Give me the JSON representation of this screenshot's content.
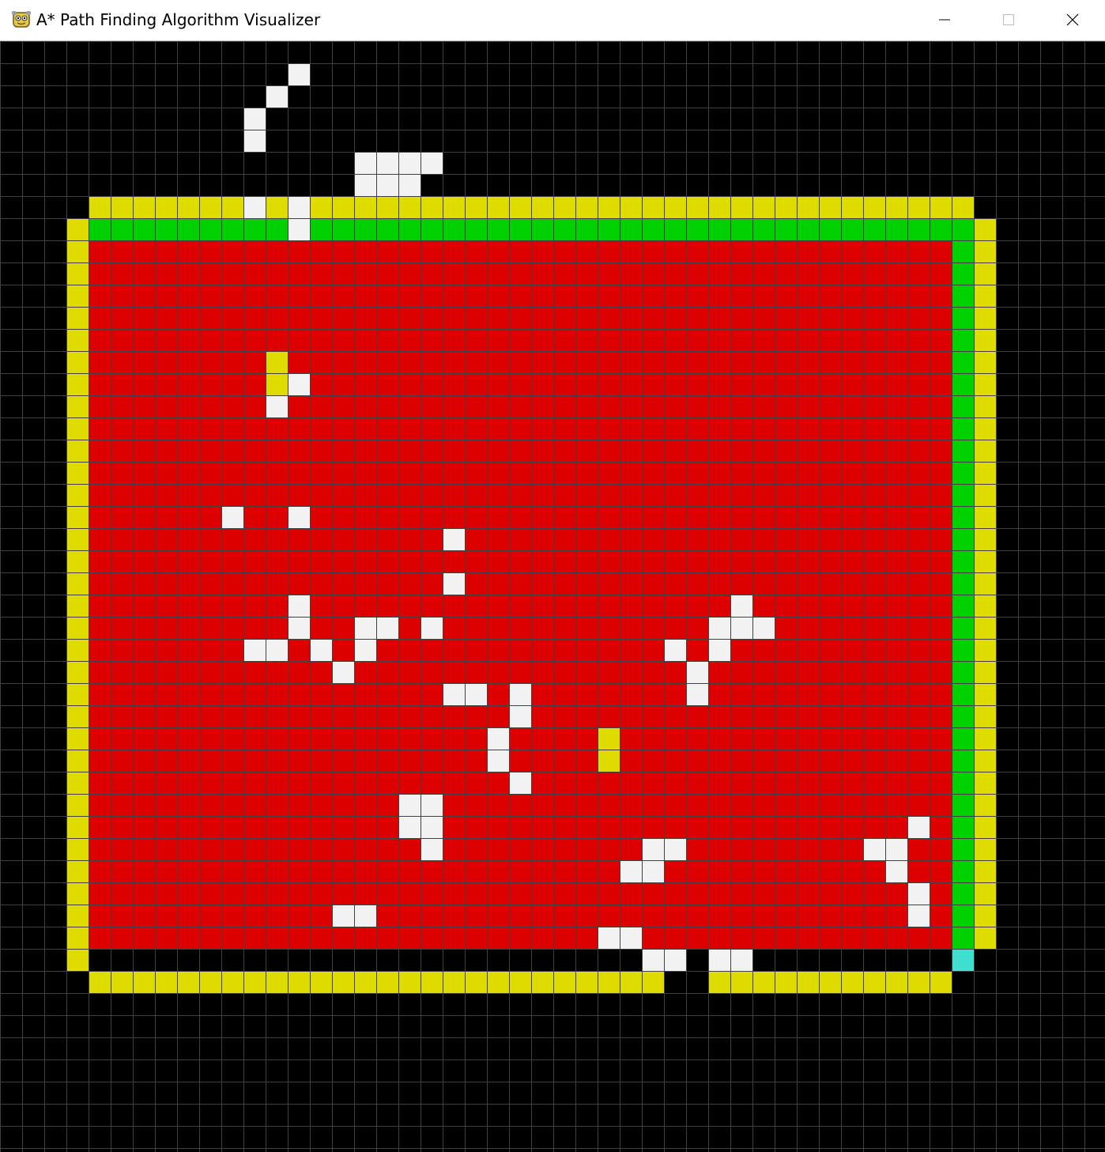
{
  "window": {
    "title": "A* Path Finding Algorithm Visualizer",
    "icon": "pygame-snake-icon",
    "controls": [
      "minimize-icon",
      "maximize-icon",
      "close-icon"
    ]
  },
  "colors": {
    "background": "#000000",
    "gridline": "#404040",
    "closed": "#dd0000",
    "open": "#e0dc00",
    "path": "#00d000",
    "barrier": "#f2f2f2",
    "end": "#40e0d0"
  },
  "grid": {
    "cols": 50,
    "rows": 50,
    "red_region": {
      "col_start": 4,
      "col_end": 42,
      "row_start": 9,
      "row_end": 40
    },
    "green_path": [
      {
        "col_from": 4,
        "col_to": 43,
        "row": 8
      },
      {
        "col": 43,
        "row_from": 8,
        "row_to": 40
      }
    ],
    "yellow_runs": [
      {
        "row": 7,
        "col_from": 4,
        "col_to": 43
      },
      {
        "col": 3,
        "row_from": 8,
        "row_to": 41
      },
      {
        "col": 44,
        "row_from": 8,
        "row_to": 40
      },
      {
        "row": 42,
        "col_from": 4,
        "col_to": 29
      },
      {
        "row": 42,
        "col_from": 32,
        "col_to": 42
      }
    ],
    "yellow_cells": [
      [
        12,
        14
      ],
      [
        12,
        15
      ],
      [
        27,
        31
      ],
      [
        27,
        32
      ]
    ],
    "barrier_cells": [
      [
        12,
        2
      ],
      [
        13,
        1
      ],
      [
        11,
        3
      ],
      [
        11,
        4
      ],
      [
        11,
        7
      ],
      [
        13,
        7
      ],
      [
        13,
        8
      ],
      [
        16,
        5
      ],
      [
        16,
        6
      ],
      [
        17,
        5
      ],
      [
        17,
        6
      ],
      [
        18,
        5
      ],
      [
        18,
        6
      ],
      [
        19,
        5
      ],
      [
        13,
        21
      ],
      [
        13,
        15
      ],
      [
        12,
        16
      ],
      [
        10,
        21
      ],
      [
        11,
        27
      ],
      [
        12,
        27
      ],
      [
        13,
        25
      ],
      [
        13,
        26
      ],
      [
        14,
        27
      ],
      [
        16,
        26
      ],
      [
        16,
        27
      ],
      [
        17,
        26
      ],
      [
        18,
        34
      ],
      [
        19,
        34
      ],
      [
        19,
        35
      ],
      [
        18,
        35
      ],
      [
        19,
        36
      ],
      [
        15,
        39
      ],
      [
        16,
        39
      ],
      [
        23,
        30
      ],
      [
        23,
        29
      ],
      [
        20,
        24
      ],
      [
        19,
        26
      ],
      [
        15,
        28
      ],
      [
        20,
        29
      ],
      [
        20,
        22
      ],
      [
        21,
        29
      ],
      [
        22,
        32
      ],
      [
        22,
        31
      ],
      [
        23,
        33
      ],
      [
        31,
        29
      ],
      [
        31,
        28
      ],
      [
        32,
        27
      ],
      [
        32,
        26
      ],
      [
        30,
        27
      ],
      [
        34,
        26
      ],
      [
        33,
        26
      ],
      [
        27,
        40
      ],
      [
        28,
        40
      ],
      [
        29,
        41
      ],
      [
        30,
        41
      ],
      [
        28,
        37
      ],
      [
        29,
        37
      ],
      [
        29,
        36
      ],
      [
        30,
        36
      ],
      [
        32,
        41
      ],
      [
        33,
        41
      ],
      [
        33,
        25
      ],
      [
        33,
        26
      ],
      [
        39,
        36
      ],
      [
        40,
        36
      ],
      [
        40,
        37
      ],
      [
        41,
        38
      ],
      [
        41,
        39
      ],
      [
        41,
        35
      ]
    ],
    "end_cell": [
      43,
      41
    ]
  }
}
